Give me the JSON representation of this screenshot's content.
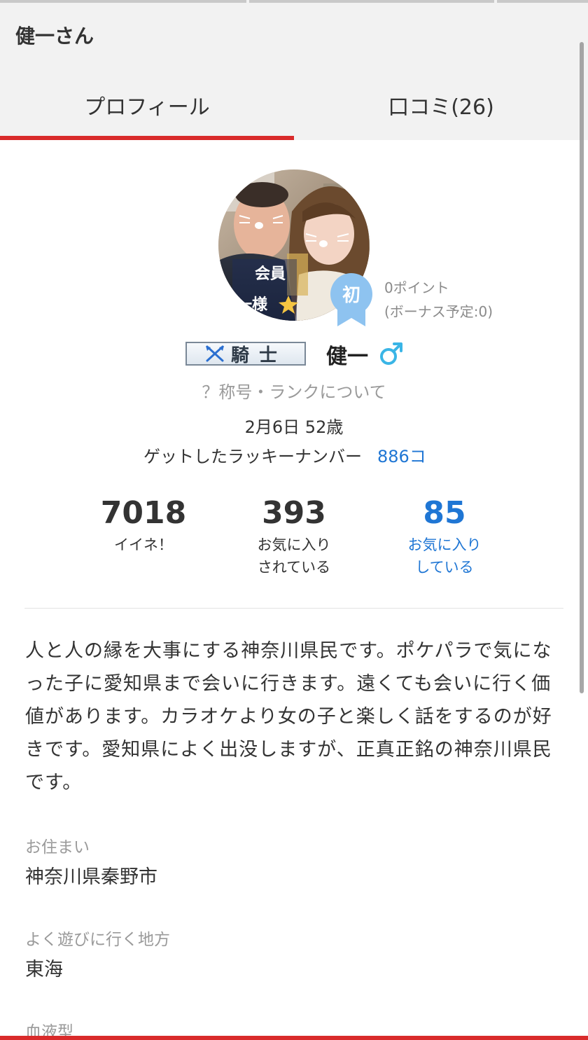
{
  "header": {
    "title": "健一さん"
  },
  "tabs": [
    {
      "label": "プロフィール",
      "active": true
    },
    {
      "label": "口コミ(26)",
      "active": false
    }
  ],
  "profile": {
    "avatar_overlay_text_1": "会員",
    "avatar_overlay_text_2": "一様",
    "first_badge": "初",
    "points": "0ポイント",
    "bonus": "(ボーナス予定:0)",
    "rank_title": "騎士",
    "name": "健一",
    "gender_icon": "male-symbol",
    "rank_link": "？称号・ランクについて",
    "birthday_age": "2月6日 52歳",
    "lucky_label": "ゲットしたラッキーナンバー",
    "lucky_value": "886コ"
  },
  "stats": [
    {
      "value": "7018",
      "label_line1": "イイネ！",
      "label_line2": ""
    },
    {
      "value": "393",
      "label_line1": "お気に入り",
      "label_line2": "されている"
    },
    {
      "value": "85",
      "label_line1": "お気に入り",
      "label_line2": "している"
    }
  ],
  "bio": "人と人の縁を大事にする神奈川県民です。ポケパラで気になった子に愛知県まで会いに行きます。遠くても会いに行く価値があります。カラオケより女の子と楽しく話をするのが好きです。愛知県によく出没しますが、正真正銘の神奈川県民です。",
  "fields": {
    "residence_label": "お住まい",
    "residence_value": "神奈川県秦野市",
    "area_label": "よく遊びに行く地方",
    "area_value": "東海",
    "blood_label": "血液型"
  },
  "colors": {
    "accent_red": "#d92b2b",
    "link_blue": "#1f76d4",
    "badge_blue": "#8ec3f0",
    "header_bg": "#f2f2f2",
    "gender_blue": "#3ab5e6"
  }
}
